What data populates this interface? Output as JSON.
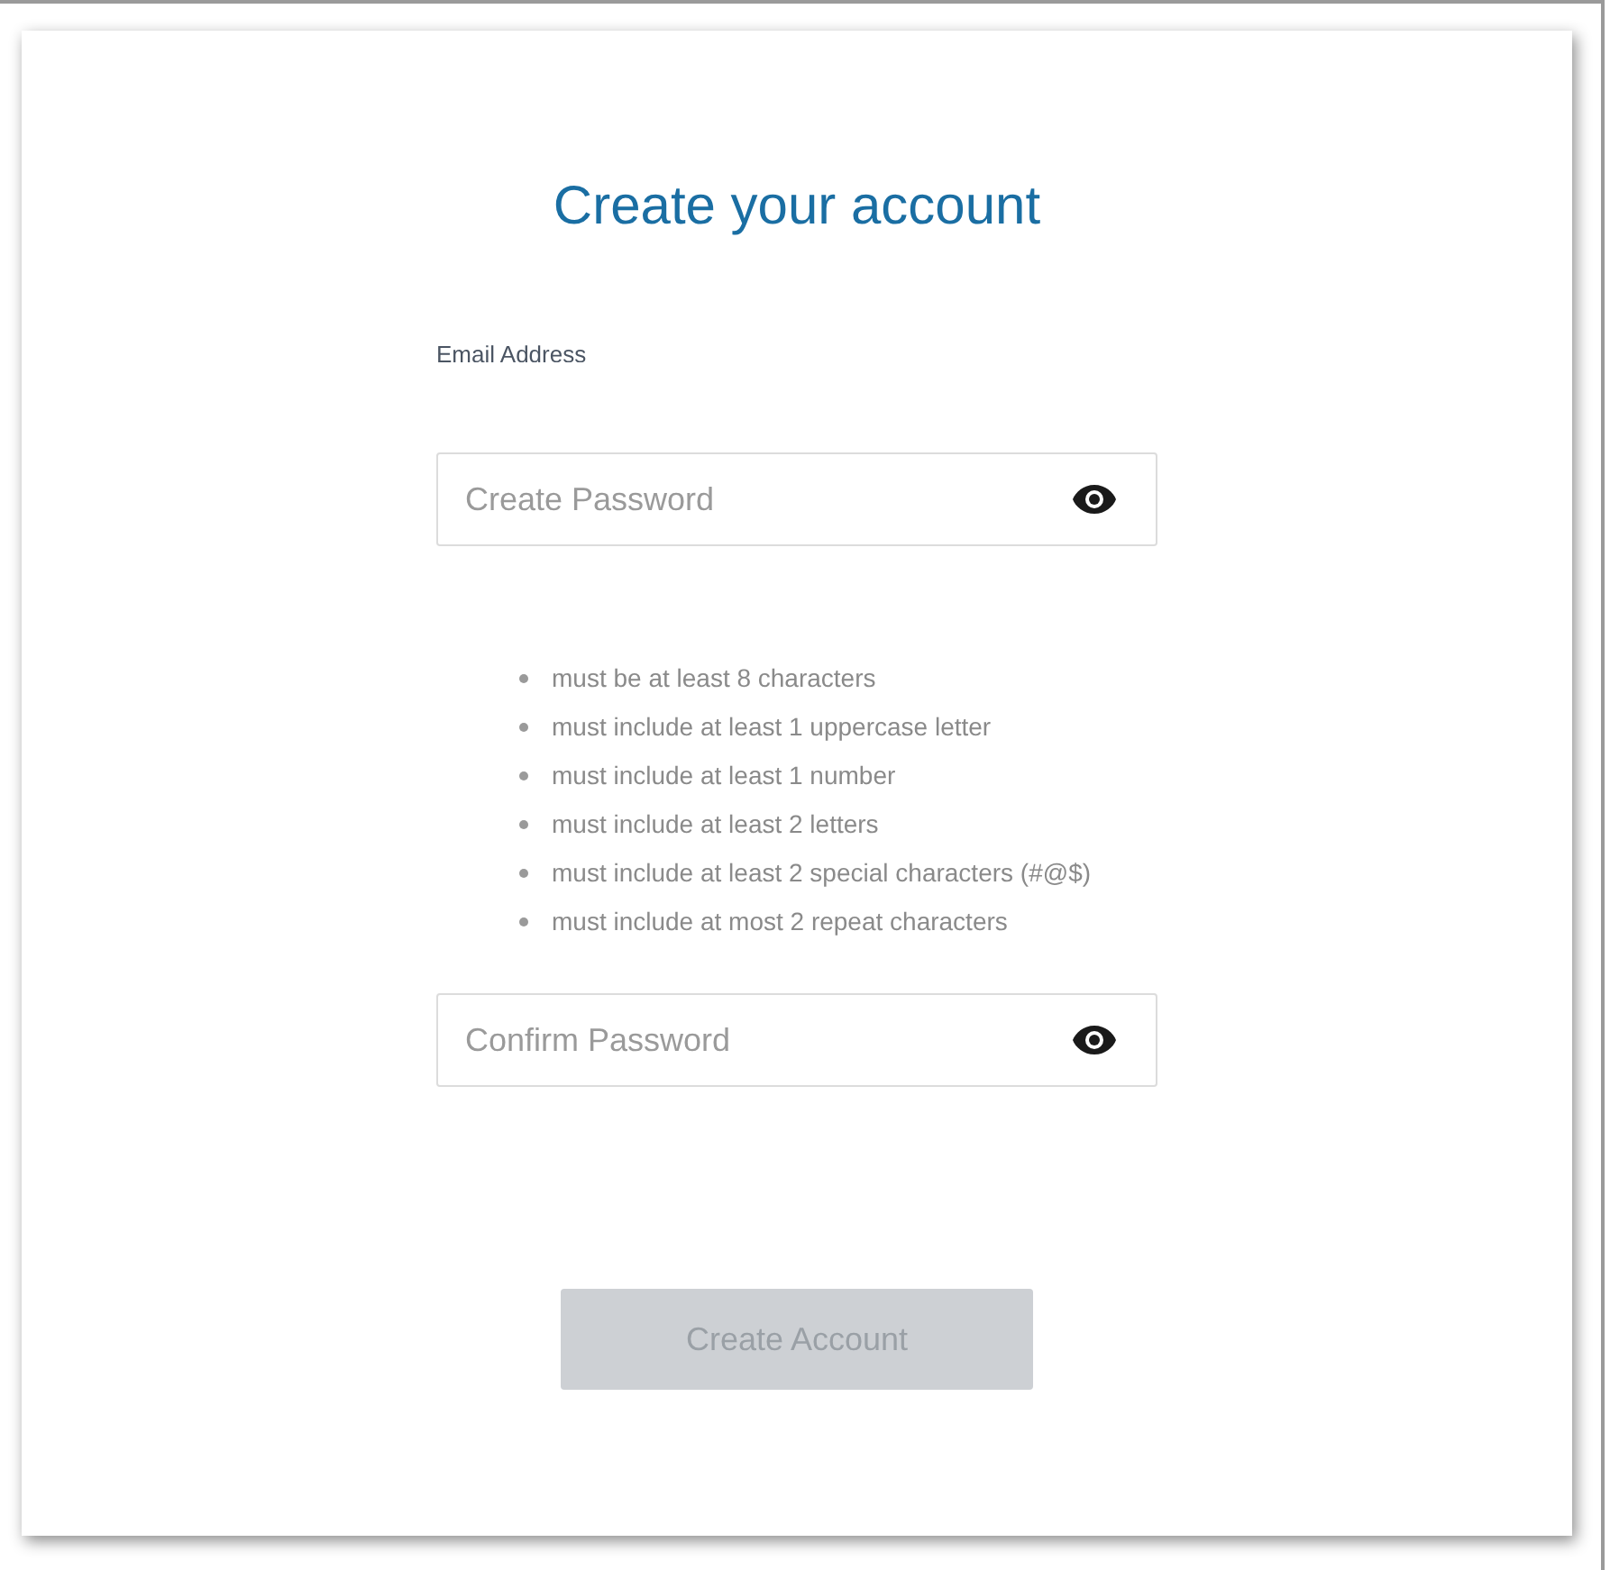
{
  "title": "Create your account",
  "email": {
    "label": "Email Address"
  },
  "password": {
    "placeholder": "Create Password"
  },
  "requirements": [
    "must be at least 8 characters",
    "must include at least 1 uppercase letter",
    "must include at least 1 number",
    "must include at least 2 letters",
    "must include at least 2 special characters (#@$)",
    "must include at most 2 repeat characters"
  ],
  "confirm": {
    "placeholder": "Confirm Password"
  },
  "submit": {
    "label": "Create Account",
    "disabled": true
  }
}
